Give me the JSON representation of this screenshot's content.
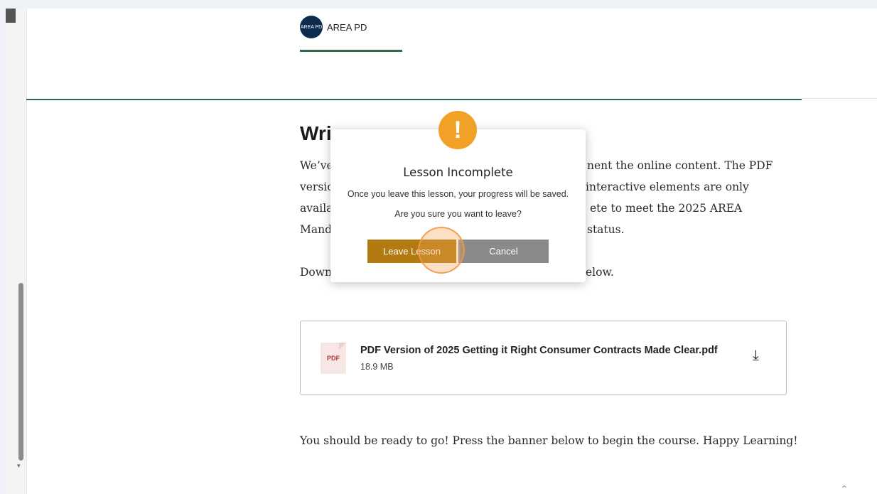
{
  "header": {
    "logo_text": "AREA PD",
    "logo_mark": "AREA PD"
  },
  "content": {
    "heading": "Wri",
    "intro_lines": [
      "We’ve",
      "versio",
      "availa",
      "Mand"
    ],
    "intro_right_lines": [
      "nent the online content. The PDF",
      "interactive elements are only",
      "ete to meet the 2025 AREA",
      "status."
    ],
    "download_left": "Down",
    "download_right": "elow.",
    "ready_text": "You should be ready to go! Press the banner below to begin the course. Happy Learning!"
  },
  "attachment": {
    "icon_label": "PDF",
    "file_name": "PDF Version of 2025 Getting it Right Consumer Contracts Made Clear.pdf",
    "file_size": "18.9 MB",
    "download_icon": "download-icon"
  },
  "modal": {
    "icon": "!",
    "title": "Lesson Incomplete",
    "message_1": "Once you leave this lesson, your progress will be saved.",
    "message_2": "Are you sure you want to leave?",
    "leave_label": "Leave Lesson",
    "cancel_label": "Cancel"
  },
  "colors": {
    "accent_green": "#2d6b4a",
    "leave_button": "#b37a10",
    "cancel_button": "#8a8a8a",
    "warning": "#f0a126"
  }
}
